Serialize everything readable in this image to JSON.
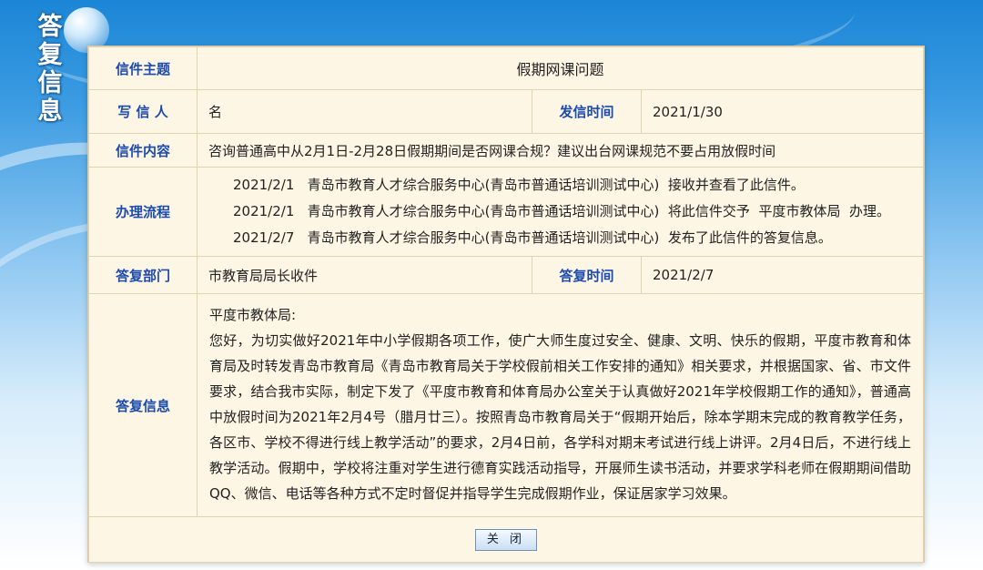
{
  "side_title": [
    "答",
    "复",
    "信",
    "息"
  ],
  "letter": {
    "subject_label": "信件主题",
    "subject": "假期网课问题",
    "writer_label": "写 信 人",
    "writer": "名",
    "sent_time_label": "发信时间",
    "sent_time": "2021/1/30",
    "content_label": "信件内容",
    "content": "咨询普通高中从2月1日-2月28日假期期间是否网课合规？建议出台网课规范不要占用放假时间",
    "process_label": "办理流程",
    "process": [
      "2021/2/1   青岛市教育人才综合服务中心(青岛市普通话培训测试中心)  接收并查看了此信件。",
      "2021/2/1   青岛市教育人才综合服务中心(青岛市普通话培训测试中心)  将此信件交予  平度市教体局  办理。",
      "2021/2/7   青岛市教育人才综合服务中心(青岛市普通话培训测试中心)  发布了此信件的答复信息。"
    ],
    "reply_dept_label": "答复部门",
    "reply_dept": "市教育局局长收件",
    "reply_time_label": "答复时间",
    "reply_time": "2021/2/7",
    "reply_label": "答复信息",
    "reply_greeting": "平度市教体局:",
    "reply_body": "您好，为切实做好2021年中小学假期各项工作，使广大师生度过安全、健康、文明、快乐的假期，平度市教育和体育局及时转发青岛市教育局《青岛市教育局关于学校假前相关工作安排的通知》相关要求，并根据国家、省、市文件要求，结合我市实际，制定下发了《平度市教育和体育局办公室关于认真做好2021年学校假期工作的通知》，普通高中放假时间为2021年2月4号（腊月廿三）。按照青岛市教育局关于“假期开始后，除本学期末完成的教育教学任务，各区市、学校不得进行线上教学活动”的要求，2月4日前，各学科对期末考试进行线上讲评。2月4日后，不进行线上教学活动。假期中，学校将注重对学生进行德育实践活动指导，开展师生读书活动，并要求学科老师在假期期间借助QQ、微信、电话等各种方式不定时督促并指导学生完成假期作业，保证居家学习效果。"
  },
  "close_button": "关 闭",
  "colors": {
    "label_blue": "#1c4bb0",
    "panel_bg": "#fdf6e4",
    "border": "#e2d2b2"
  }
}
